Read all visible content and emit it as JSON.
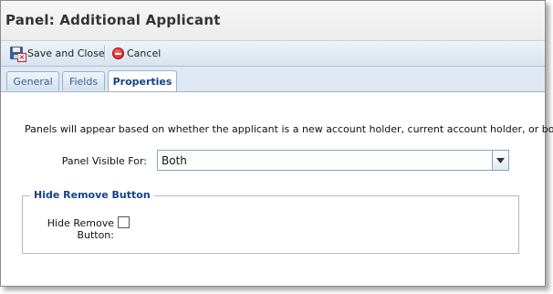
{
  "panel": {
    "title": "Panel: Additional Applicant"
  },
  "toolbar": {
    "save_close_label": "Save and Close",
    "cancel_label": "Cancel"
  },
  "tabs": [
    {
      "label": "General",
      "active": false
    },
    {
      "label": "Fields",
      "active": false
    },
    {
      "label": "Properties",
      "active": true
    }
  ],
  "properties": {
    "description": "Panels will appear based on whether the applicant is a new account holder, current account holder, or both.",
    "panel_visible_label": "Panel Visible For:",
    "panel_visible_value": "Both",
    "hide_remove_section": "Hide Remove Button",
    "hide_remove_label_line1": "Hide Remove",
    "hide_remove_label_line2": "Button:",
    "hide_remove_checked": false
  },
  "colors": {
    "accent": "#15428b",
    "tab_text": "#395f8b",
    "toolbar_bg": "#dce6f1"
  },
  "icons": {
    "save": "save-close-icon",
    "cancel": "cancel-icon",
    "dropdown": "chevron-down-icon"
  }
}
